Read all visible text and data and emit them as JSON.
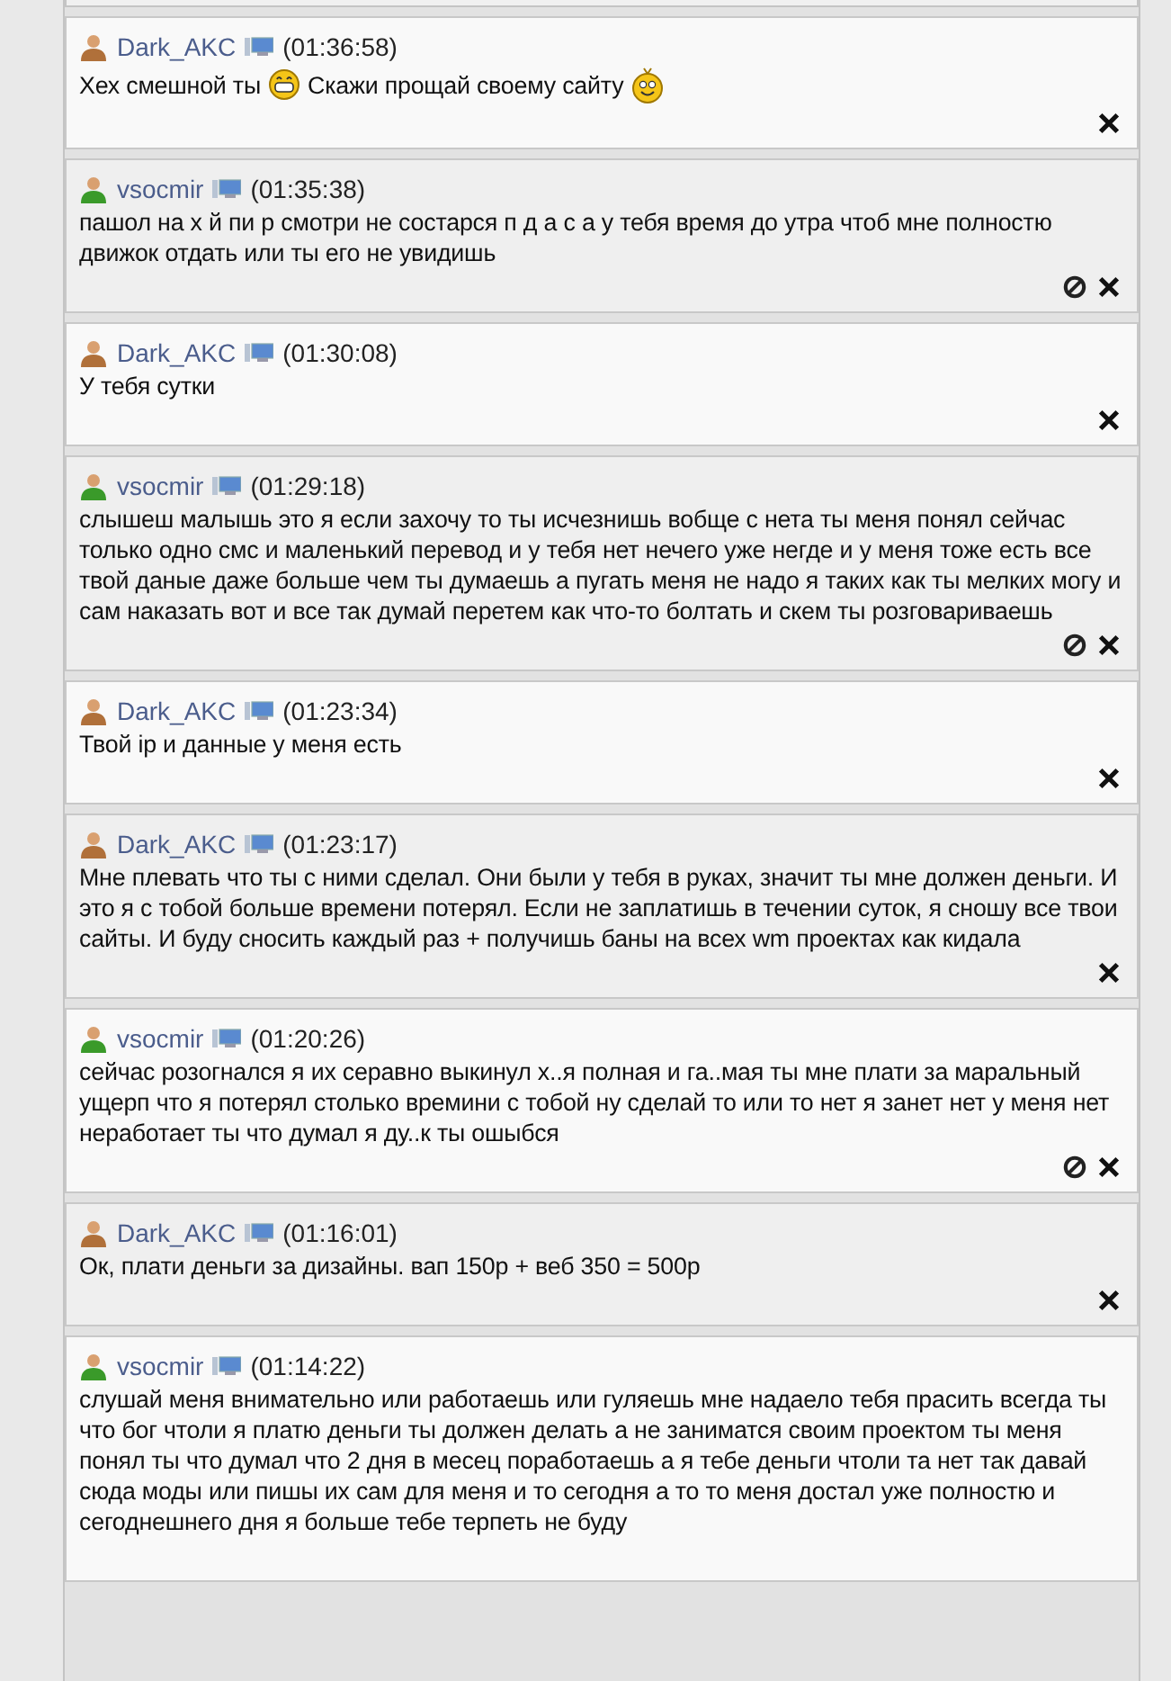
{
  "posts": [
    {
      "author": "Dark_AKC",
      "color": "#b0703a",
      "time": "(01:36:58)",
      "body": [
        {
          "kind": "text",
          "text": "Хех смешной ты"
        },
        {
          "kind": "grin"
        },
        {
          "kind": "text",
          "text": "Скажи прощай своему сайту"
        },
        {
          "kind": "wave"
        }
      ],
      "can_ban": false,
      "can_delete": true
    },
    {
      "author": "vsocmir",
      "color": "#3a9a2a",
      "time": "(01:35:38)",
      "body": [
        {
          "kind": "text",
          "text": "пашол на х й пи р смотри не состарся п д а с а у тебя время до утра чтоб мне полностю движок отдать или ты его не увидишь"
        }
      ],
      "can_ban": true,
      "can_delete": true
    },
    {
      "author": "Dark_AKC",
      "color": "#b0703a",
      "time": "(01:30:08)",
      "body": [
        {
          "kind": "text",
          "text": "У тебя сутки"
        }
      ],
      "can_ban": false,
      "can_delete": true
    },
    {
      "author": "vsocmir",
      "color": "#3a9a2a",
      "time": "(01:29:18)",
      "body": [
        {
          "kind": "text",
          "text": "слышеш малышь это я если захочу то ты исчезнишь вобще с нета ты меня понял сейчас только одно смс и маленький перевод и у тебя нет нечего уже негде и у меня тоже есть все твой даные даже больше чем ты думаешь а пугать меня не надо я таких как ты мелких могу и сам наказать вот и все так думай перетем как что-то болтать и скем ты розговариваешь"
        }
      ],
      "can_ban": true,
      "can_delete": true
    },
    {
      "author": "Dark_AKC",
      "color": "#b0703a",
      "time": "(01:23:34)",
      "body": [
        {
          "kind": "text",
          "text": "Твой ip и данные у меня есть"
        }
      ],
      "can_ban": false,
      "can_delete": true
    },
    {
      "author": "Dark_AKC",
      "color": "#b0703a",
      "time": "(01:23:17)",
      "body": [
        {
          "kind": "text",
          "text": "Мне плевать что ты с ними сделал. Они были у тебя в руках, значит ты мне должен деньги. И это я с тобой больше времени потерял. Если не заплатишь в течении суток, я сношу все твои сайты. И буду сносить каждый раз + получишь баны на всех wm проектах как кидала"
        }
      ],
      "can_ban": false,
      "can_delete": true
    },
    {
      "author": "vsocmir",
      "color": "#3a9a2a",
      "time": "(01:20:26)",
      "body": [
        {
          "kind": "text",
          "text": "сейчас розогнался я их серавно выкинул х..я полная и га..мая ты мне плати за маральный ущерп что я потерял столько времини с тобой ну сделай то или то нет я занет нет у меня нет неработает ты что думал я ду..к ты ошыбся"
        }
      ],
      "can_ban": true,
      "can_delete": true
    },
    {
      "author": "Dark_AKC",
      "color": "#b0703a",
      "time": "(01:16:01)",
      "body": [
        {
          "kind": "text",
          "text": "Ок, плати деньги за дизайны. вап 150р + веб 350 = 500р"
        }
      ],
      "can_ban": false,
      "can_delete": true
    },
    {
      "author": "vsocmir",
      "color": "#3a9a2a",
      "time": "(01:14:22)",
      "body": [
        {
          "kind": "text",
          "text": "слушай меня внимательно или работаешь или гуляешь мне надаело тебя прасить всегда ты что бог чтоли я платю деньги ты должен делать а не заниматся своим проектом ты меня понял ты что думал что 2 дня в месец поработаешь а я тебе деньги чтоли та нет так давай сюда моды или пишы их сам для меня и то сегодня а то то меня достал уже полностю и сегоднешнего дня я больше тебе терпеть не буду"
        }
      ],
      "can_ban": false,
      "can_delete": false
    }
  ]
}
